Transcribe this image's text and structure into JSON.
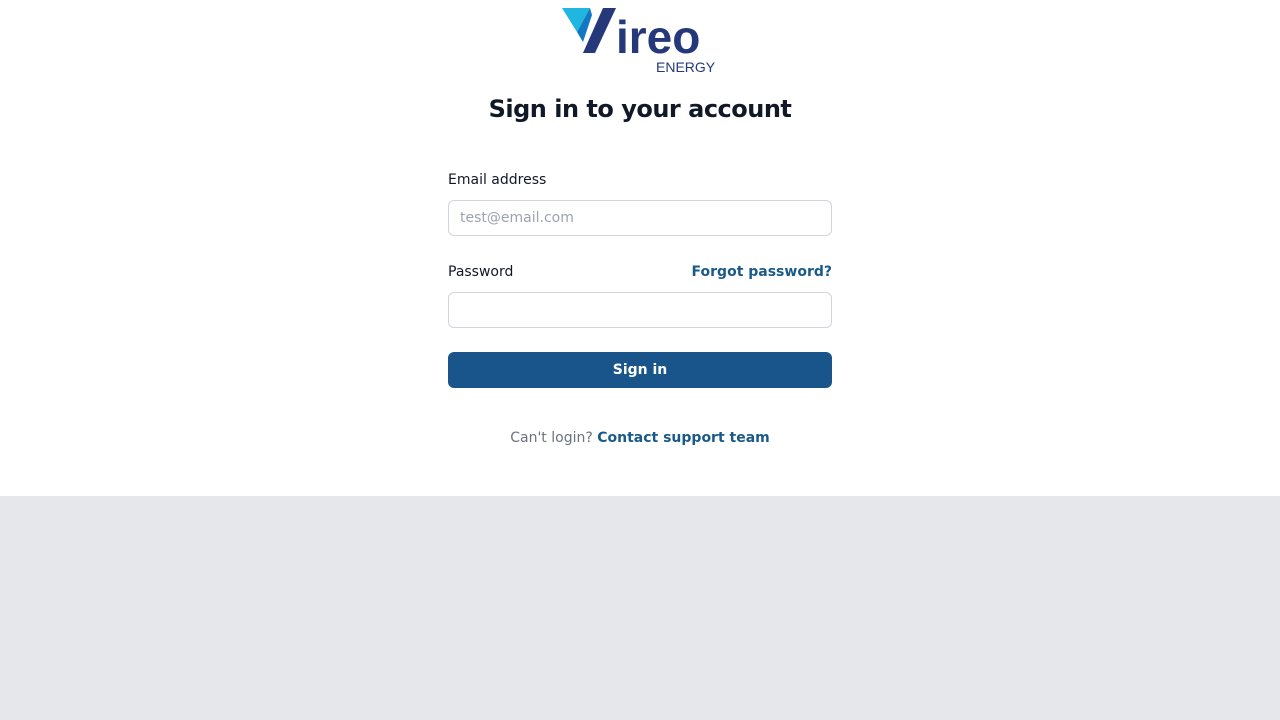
{
  "brand": {
    "name": "ireo",
    "subtitle": "ENERGY",
    "colors": {
      "navy": "#25397a",
      "cyan": "#1fb6e0",
      "blue": "#1378c4"
    }
  },
  "page": {
    "title": "Sign in to your account"
  },
  "form": {
    "email": {
      "label": "Email address",
      "placeholder": "test@email.com",
      "value": ""
    },
    "password": {
      "label": "Password",
      "value": ""
    },
    "forgot_label": "Forgot password?",
    "submit_label": "Sign in"
  },
  "support": {
    "prefix": "Can't login?",
    "link_label": "Contact support team"
  },
  "colors": {
    "accent": "#19558a",
    "link": "#1a5a8a",
    "background": "#e5e7eb"
  }
}
